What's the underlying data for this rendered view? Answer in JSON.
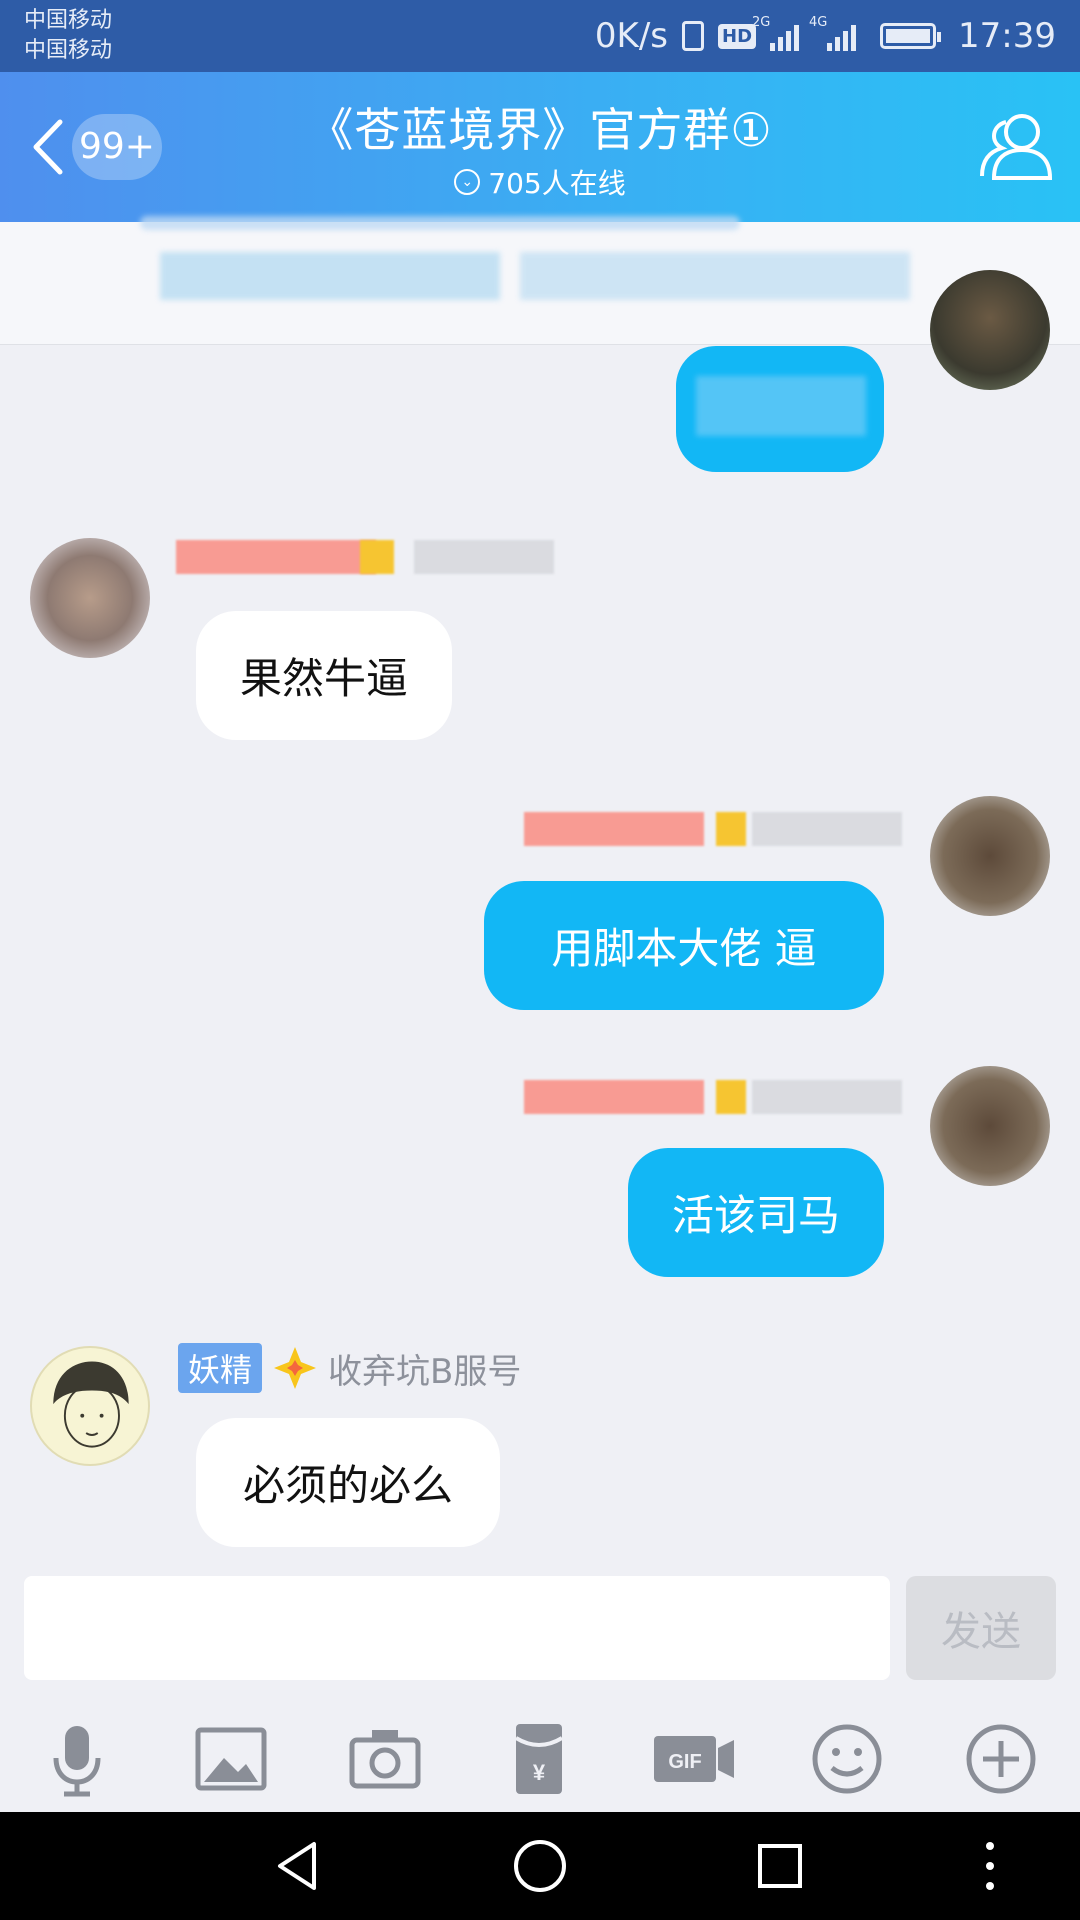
{
  "status_bar": {
    "carrier_1": "中国移动",
    "carrier_2": "中国移动",
    "net_speed": "0K/s",
    "hd": "HD",
    "net_a": "2G",
    "net_b": "4G",
    "time": "17:39"
  },
  "header": {
    "unread_badge": "99+",
    "title": "《苍蓝境界》官方群①",
    "online": "705人在线",
    "colors": {
      "start": "#4f8fee",
      "end": "#29c2f5"
    }
  },
  "messages": [
    {
      "side": "out",
      "text": ""
    },
    {
      "side": "in",
      "text": "果然牛逼"
    },
    {
      "side": "out",
      "text": "用脚本大佬 逼"
    },
    {
      "side": "out",
      "text": "活该司马"
    },
    {
      "side": "in",
      "tag": "妖精",
      "nickname": "收弃坑B服号",
      "text": "必须的必么"
    }
  ],
  "input": {
    "value": "",
    "send_label": "发送"
  },
  "toolbar": {
    "icons": [
      "microphone-icon",
      "image-icon",
      "camera-icon",
      "red-packet-icon",
      "gif-icon",
      "emoji-icon",
      "plus-icon"
    ]
  },
  "colors": {
    "outgoing_bubble": "#12b7f5",
    "incoming_bubble": "#ffffff",
    "background": "#eff0f5"
  }
}
